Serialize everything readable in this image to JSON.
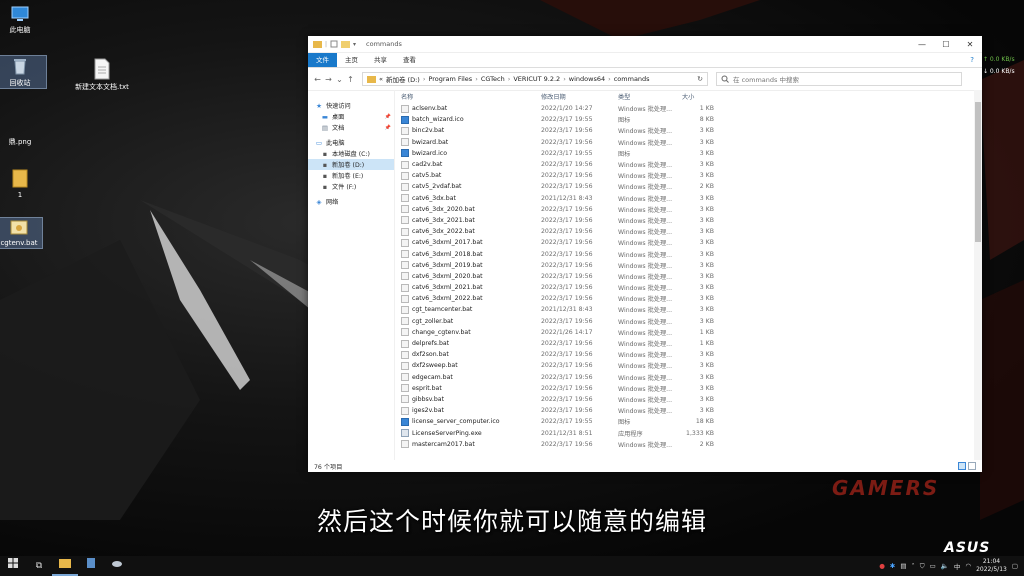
{
  "desktop": {
    "icons": [
      {
        "label": "此电脑",
        "icon": "computer-icon"
      },
      {
        "label": "回收站",
        "icon": "recycle-bin-icon"
      },
      {
        "label": "新建文本文档.txt",
        "icon": "text-file-icon"
      },
      {
        "label": "鼎.png",
        "icon": "image-file-icon"
      },
      {
        "label": "1",
        "icon": "folder-icon"
      },
      {
        "label": "cgtenv.bat",
        "icon": "bat-file-icon"
      }
    ]
  },
  "explorer": {
    "title": "commands",
    "window_controls": {
      "minimize": "—",
      "maximize": "☐",
      "close": "✕"
    },
    "ribbon_tabs": [
      "文件",
      "主页",
      "共享",
      "查看"
    ],
    "help": "?",
    "nav_buttons": {
      "back": "←",
      "forward": "→",
      "recent": "⌄",
      "up": "↑"
    },
    "path": [
      "«",
      "新加卷 (D:)",
      "Program Files",
      "CGTech",
      "VERICUT 9.2.2",
      "windows64",
      "commands"
    ],
    "path_sep": "›",
    "refresh": "↻",
    "search_placeholder": "在 commands 中搜索",
    "nav_items": [
      {
        "label": "快速访问",
        "icon": "star-icon",
        "pinned": false
      },
      {
        "label": "桌面",
        "icon": "desktop-icon",
        "pinned": true
      },
      {
        "label": "文档",
        "icon": "documents-icon",
        "pinned": true
      },
      {
        "label": "此电脑",
        "icon": "computer-icon",
        "pinned": false
      },
      {
        "label": "本地磁盘 (C:)",
        "icon": "drive-icon",
        "pinned": false
      },
      {
        "label": "新加卷 (D:)",
        "icon": "drive-icon",
        "pinned": false
      },
      {
        "label": "新加卷 (E:)",
        "icon": "drive-icon",
        "pinned": false
      },
      {
        "label": "文件 (F:)",
        "icon": "drive-icon",
        "pinned": false
      },
      {
        "label": "网络",
        "icon": "network-icon",
        "pinned": false
      }
    ],
    "columns": {
      "name": "名称",
      "date": "修改日期",
      "type": "类型",
      "size": "大小"
    },
    "files": [
      {
        "name": "aclsenv.bat",
        "date": "2022/1/20 14:27",
        "type": "Windows 批处理...",
        "size": "1 KB",
        "kind": "bat"
      },
      {
        "name": "batch_wizard.ico",
        "date": "2022/3/17 19:55",
        "type": "图标",
        "size": "8 KB",
        "kind": "ico"
      },
      {
        "name": "binc2v.bat",
        "date": "2022/3/17 19:56",
        "type": "Windows 批处理...",
        "size": "3 KB",
        "kind": "bat"
      },
      {
        "name": "bwizard.bat",
        "date": "2022/3/17 19:56",
        "type": "Windows 批处理...",
        "size": "3 KB",
        "kind": "bat"
      },
      {
        "name": "bwizard.ico",
        "date": "2022/3/17 19:55",
        "type": "图标",
        "size": "3 KB",
        "kind": "ico"
      },
      {
        "name": "cad2v.bat",
        "date": "2022/3/17 19:56",
        "type": "Windows 批处理...",
        "size": "3 KB",
        "kind": "bat"
      },
      {
        "name": "catv5.bat",
        "date": "2022/3/17 19:56",
        "type": "Windows 批处理...",
        "size": "3 KB",
        "kind": "bat"
      },
      {
        "name": "catv5_2vdaf.bat",
        "date": "2022/3/17 19:56",
        "type": "Windows 批处理...",
        "size": "2 KB",
        "kind": "bat"
      },
      {
        "name": "catv6_3dx.bat",
        "date": "2021/12/31 8:43",
        "type": "Windows 批处理...",
        "size": "3 KB",
        "kind": "bat"
      },
      {
        "name": "catv6_3dx_2020.bat",
        "date": "2022/3/17 19:56",
        "type": "Windows 批处理...",
        "size": "3 KB",
        "kind": "bat"
      },
      {
        "name": "catv6_3dx_2021.bat",
        "date": "2022/3/17 19:56",
        "type": "Windows 批处理...",
        "size": "3 KB",
        "kind": "bat"
      },
      {
        "name": "catv6_3dx_2022.bat",
        "date": "2022/3/17 19:56",
        "type": "Windows 批处理...",
        "size": "3 KB",
        "kind": "bat"
      },
      {
        "name": "catv6_3dxml_2017.bat",
        "date": "2022/3/17 19:56",
        "type": "Windows 批处理...",
        "size": "3 KB",
        "kind": "bat"
      },
      {
        "name": "catv6_3dxml_2018.bat",
        "date": "2022/3/17 19:56",
        "type": "Windows 批处理...",
        "size": "3 KB",
        "kind": "bat"
      },
      {
        "name": "catv6_3dxml_2019.bat",
        "date": "2022/3/17 19:56",
        "type": "Windows 批处理...",
        "size": "3 KB",
        "kind": "bat"
      },
      {
        "name": "catv6_3dxml_2020.bat",
        "date": "2022/3/17 19:56",
        "type": "Windows 批处理...",
        "size": "3 KB",
        "kind": "bat"
      },
      {
        "name": "catv6_3dxml_2021.bat",
        "date": "2022/3/17 19:56",
        "type": "Windows 批处理...",
        "size": "3 KB",
        "kind": "bat"
      },
      {
        "name": "catv6_3dxml_2022.bat",
        "date": "2022/3/17 19:56",
        "type": "Windows 批处理...",
        "size": "3 KB",
        "kind": "bat"
      },
      {
        "name": "cgt_teamcenter.bat",
        "date": "2021/12/31 8:43",
        "type": "Windows 批处理...",
        "size": "3 KB",
        "kind": "bat"
      },
      {
        "name": "cgt_zoller.bat",
        "date": "2022/3/17 19:56",
        "type": "Windows 批处理...",
        "size": "3 KB",
        "kind": "bat"
      },
      {
        "name": "change_cgtenv.bat",
        "date": "2022/1/26 14:17",
        "type": "Windows 批处理...",
        "size": "1 KB",
        "kind": "bat"
      },
      {
        "name": "delprefs.bat",
        "date": "2022/3/17 19:56",
        "type": "Windows 批处理...",
        "size": "1 KB",
        "kind": "bat"
      },
      {
        "name": "dxf2son.bat",
        "date": "2022/3/17 19:56",
        "type": "Windows 批处理...",
        "size": "3 KB",
        "kind": "bat"
      },
      {
        "name": "dxf2sweep.bat",
        "date": "2022/3/17 19:56",
        "type": "Windows 批处理...",
        "size": "3 KB",
        "kind": "bat"
      },
      {
        "name": "edgecam.bat",
        "date": "2022/3/17 19:56",
        "type": "Windows 批处理...",
        "size": "3 KB",
        "kind": "bat"
      },
      {
        "name": "esprit.bat",
        "date": "2022/3/17 19:56",
        "type": "Windows 批处理...",
        "size": "3 KB",
        "kind": "bat"
      },
      {
        "name": "gibbsv.bat",
        "date": "2022/3/17 19:56",
        "type": "Windows 批处理...",
        "size": "3 KB",
        "kind": "bat"
      },
      {
        "name": "iges2v.bat",
        "date": "2022/3/17 19:56",
        "type": "Windows 批处理...",
        "size": "3 KB",
        "kind": "bat"
      },
      {
        "name": "license_server_computer.ico",
        "date": "2022/3/17 19:55",
        "type": "图标",
        "size": "18 KB",
        "kind": "ico"
      },
      {
        "name": "LicenseServerPing.exe",
        "date": "2021/12/31 8:51",
        "type": "应用程序",
        "size": "1,333 KB",
        "kind": "exe"
      },
      {
        "name": "mastercam2017.bat",
        "date": "2022/3/17 19:56",
        "type": "Windows 批处理...",
        "size": "2 KB",
        "kind": "bat"
      }
    ],
    "status": "76 个项目"
  },
  "net_speed": {
    "up": "↑ 0.0 KB/s",
    "down": "↓ 0.0 KB/s"
  },
  "subtitle": "然后这个时候你就可以随意的编辑",
  "watermark": "GAMERS",
  "brand": "ASUS",
  "taskbar": {
    "start_icon": "windows-start-icon",
    "time": "21:04",
    "date": "2022/5/13"
  }
}
